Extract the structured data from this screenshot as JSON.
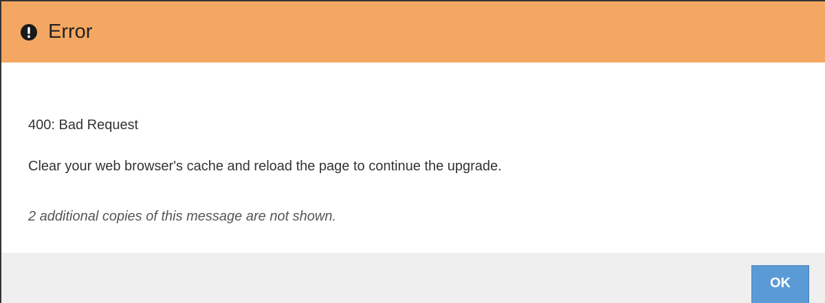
{
  "dialog": {
    "title": "Error",
    "icon": "exclamation-circle-icon",
    "header_color": "#f4a762",
    "messages": {
      "code": "400: Bad Request",
      "text": "Clear your web browser's cache and reload the page to continue the upgrade.",
      "note": "2 additional copies of this message are not shown."
    },
    "footer": {
      "ok_label": "OK"
    },
    "button_color": "#5b9bd5"
  }
}
